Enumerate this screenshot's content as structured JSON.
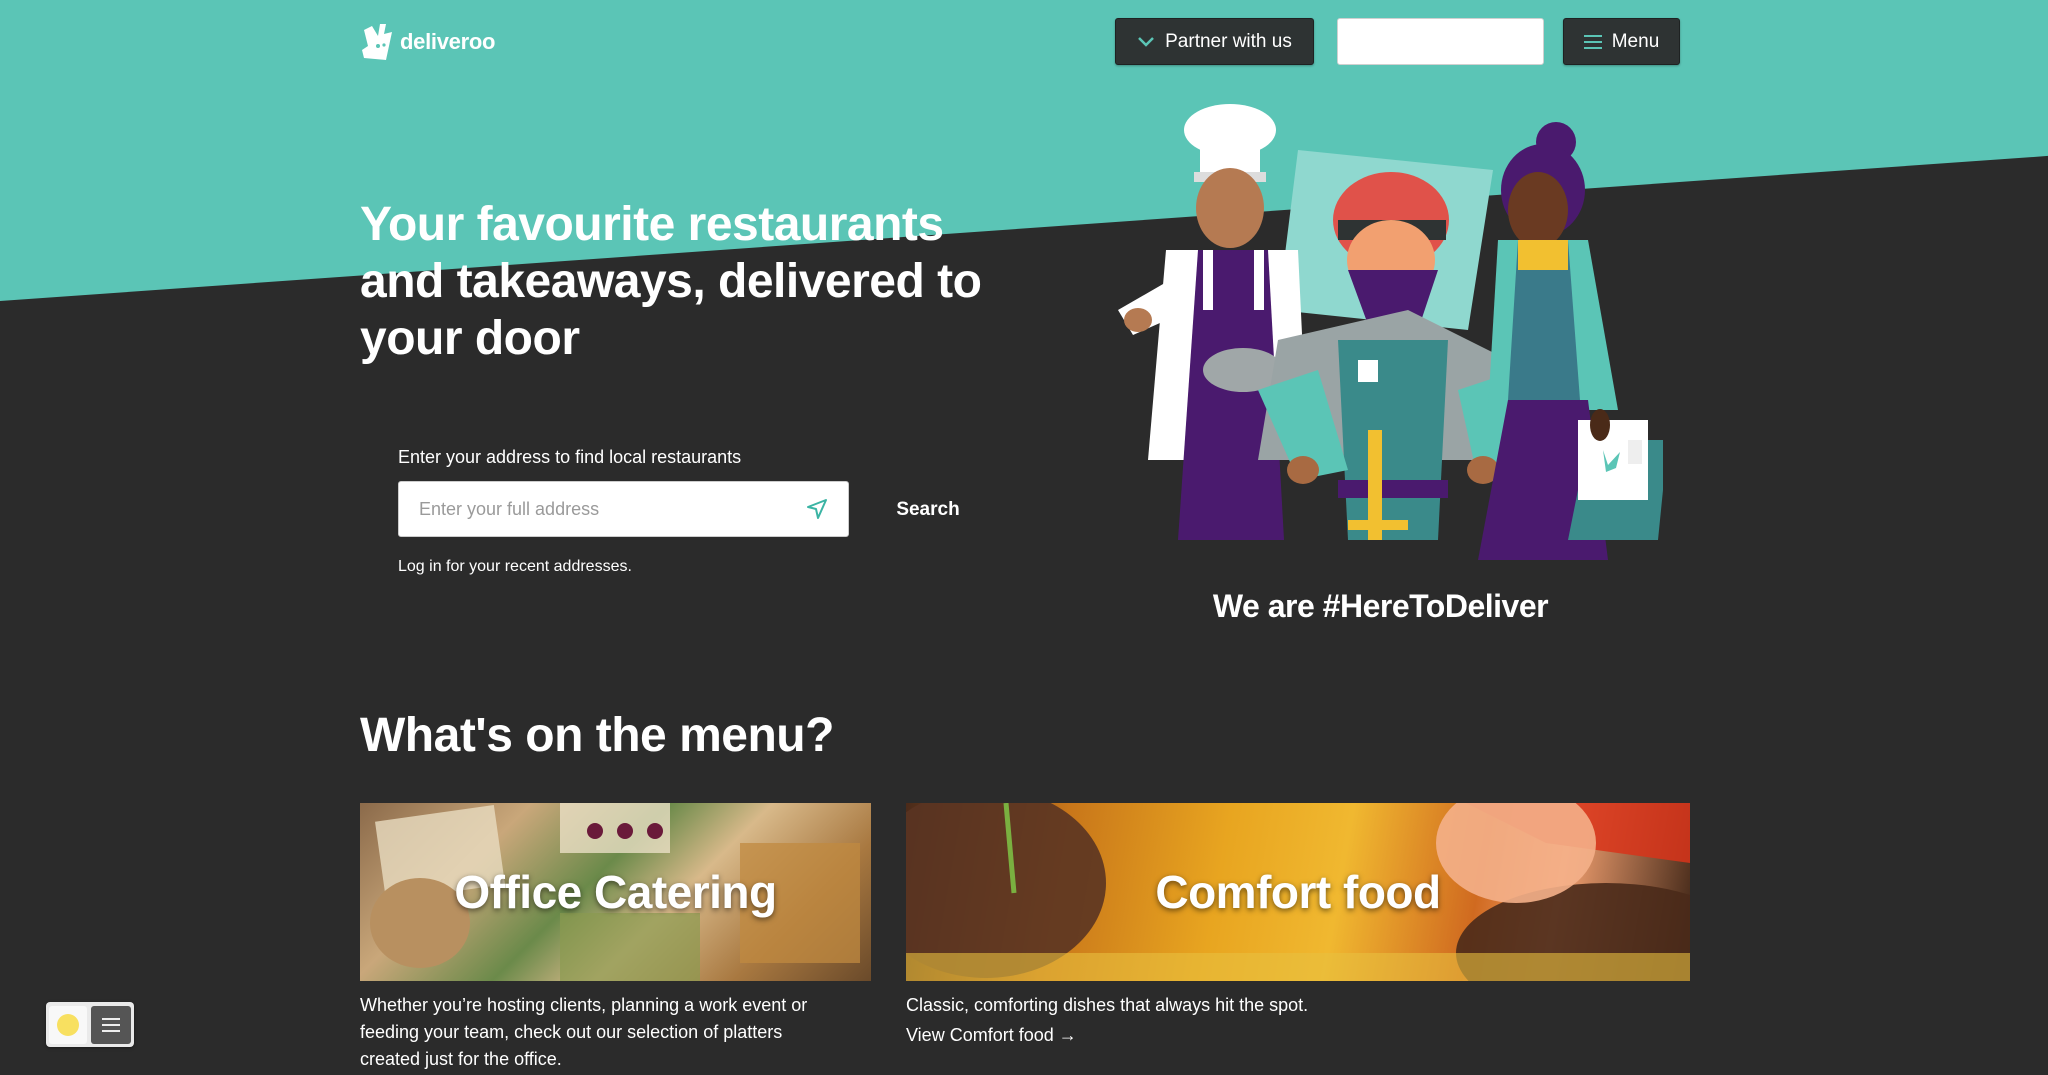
{
  "header": {
    "logo_text": "deliveroo",
    "partner_label": "Partner with us",
    "menu_label": "Menu"
  },
  "hero": {
    "title": "Your favourite restaurants and takeaways, delivered to your door",
    "address_label": "Enter your address to find local restaurants",
    "address_placeholder": "Enter your full address",
    "search_label": "Search",
    "login_note": "Log in for your recent addresses.",
    "tagline": "We are #HereToDeliver"
  },
  "menu_section": {
    "heading": "What's on the menu?",
    "cards": [
      {
        "title": "Office Catering",
        "description": "Whether you’re hosting clients, planning a work event or feeding your team, check out our selection of platters created just for the office."
      },
      {
        "title": "Comfort food",
        "description": "Classic, comforting dishes that always hit the spot.",
        "link": "View Comfort food →"
      }
    ]
  },
  "colors": {
    "teal": "#5bc5b6",
    "background": "#2b2b2b",
    "button_dark": "#2e3333",
    "accent_purple": "#4a1a6e"
  },
  "icons": [
    "deliveroo-logo-icon",
    "chevron-down-icon",
    "hamburger-icon",
    "location-arrow-icon",
    "sun-icon",
    "menu-lines-icon"
  ]
}
